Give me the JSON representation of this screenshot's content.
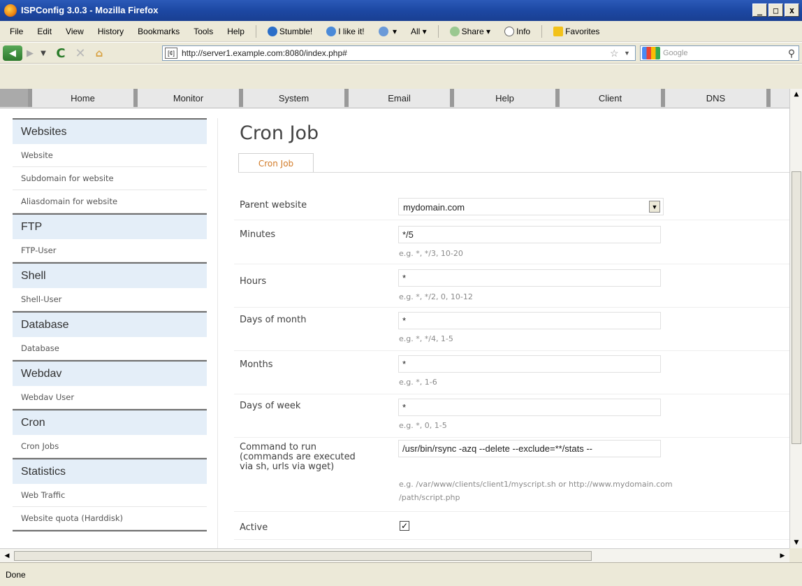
{
  "window": {
    "title": "ISPConfig 3.0.3 - Mozilla Firefox",
    "controls": [
      "_",
      "□",
      "x"
    ]
  },
  "menubar": {
    "items": [
      "File",
      "Edit",
      "View",
      "History",
      "Bookmarks",
      "Tools",
      "Help"
    ],
    "stumble": "Stumble!",
    "like": "I like it!",
    "all": "All",
    "share": "Share",
    "info": "Info",
    "favorites": "Favorites"
  },
  "navbar": {
    "url": "http://server1.example.com:8080/index.php#",
    "search_placeholder": "Google",
    "site_icon": "[¢]"
  },
  "tabs": [
    "Home",
    "Monitor",
    "System",
    "Email",
    "Help",
    "Client",
    "DNS"
  ],
  "sidebar": {
    "groups": [
      {
        "title": "Websites",
        "items": [
          "Website",
          "Subdomain for website",
          "Aliasdomain for website"
        ]
      },
      {
        "title": "FTP",
        "items": [
          "FTP-User"
        ]
      },
      {
        "title": "Shell",
        "items": [
          "Shell-User"
        ]
      },
      {
        "title": "Database",
        "items": [
          "Database"
        ]
      },
      {
        "title": "Webdav",
        "items": [
          "Webdav User"
        ]
      },
      {
        "title": "Cron",
        "items": [
          "Cron Jobs"
        ]
      },
      {
        "title": "Statistics",
        "items": [
          "Web Traffic",
          "Website quota (Harddisk)"
        ]
      }
    ]
  },
  "main": {
    "title": "Cron Job",
    "subtab": "Cron Job",
    "form": {
      "parent_website": {
        "label": "Parent website",
        "value": "mydomain.com"
      },
      "minutes": {
        "label": "Minutes",
        "value": "*/5",
        "hint": "e.g. *, */3, 10-20"
      },
      "hours": {
        "label": "Hours",
        "value": "*",
        "hint": "e.g. *, */2, 0, 10-12"
      },
      "days_of_month": {
        "label": "Days of month",
        "value": "*",
        "hint": "e.g. *, */4, 1-5"
      },
      "months": {
        "label": "Months",
        "value": "*",
        "hint": "e.g. *, 1-6"
      },
      "days_of_week": {
        "label": "Days of week",
        "value": "*",
        "hint": "e.g. *, 0, 1-5"
      },
      "command": {
        "label_line1": "Command to run",
        "label_line2": "(commands are executed",
        "label_line3": "via sh, urls via wget)",
        "value": "/usr/bin/rsync -azq --delete --exclude=**/stats --",
        "hint_line1": "e.g. /var/www/clients/client1/myscript.sh or http://www.mydomain.com",
        "hint_line2": "/path/script.php"
      },
      "active": {
        "label": "Active",
        "checked": "☑"
      }
    }
  },
  "status": "Done",
  "icons": {
    "firefox": "firefox-icon",
    "back": "◀",
    "forward": "▶",
    "dropdown": "▼",
    "reload": "C",
    "stop": "✕",
    "home": "⌂",
    "star": "☆",
    "magnifier": "⚲",
    "checkmark": "✓"
  }
}
